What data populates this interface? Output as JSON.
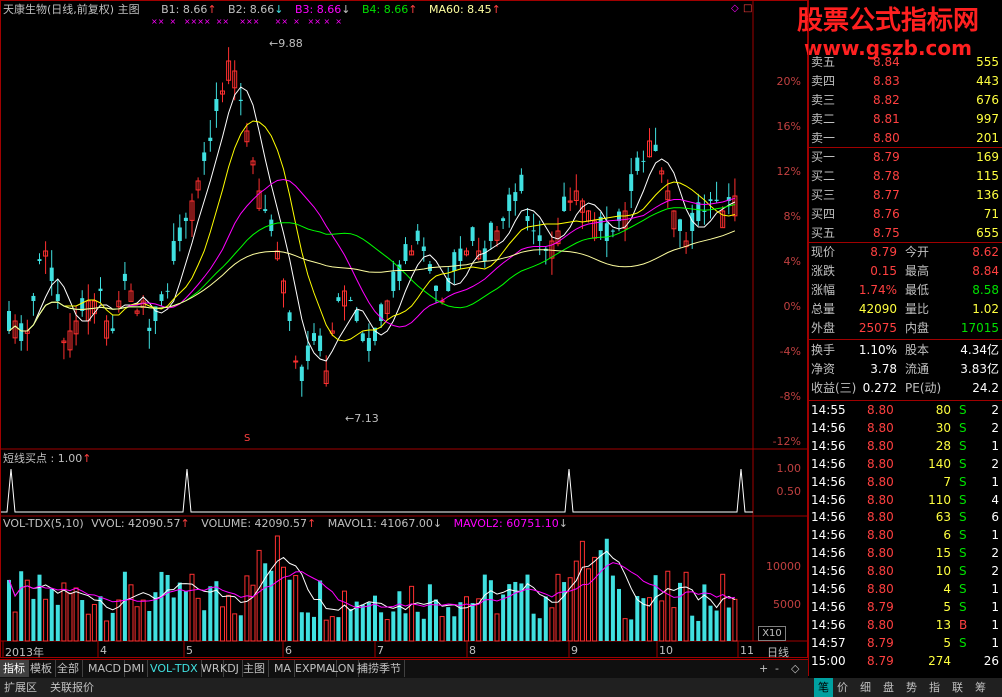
{
  "header": {
    "title": "天康生物(日线,前复权) 主图",
    "b1": "B1: 8.66",
    "b2": "B2: 8.66",
    "b3": "B3: 8.66",
    "b4": "B4: 8.66",
    "ma60": "MA60: 8.45"
  },
  "watermark": {
    "line1": "股票公式指标网",
    "line2": "www.gszb.com"
  },
  "main_chart": {
    "y_labels": [
      "20%",
      "16%",
      "12%",
      "8%",
      "4%",
      "0%",
      "-4%",
      "-8%",
      "-12%"
    ],
    "high_label": "9.88",
    "low_label": "7.13",
    "s_marker": "S"
  },
  "signal_panel": {
    "title": "短线买点 : 1.00",
    "y_labels": [
      "1.00",
      "0.50"
    ]
  },
  "volume_panel": {
    "title": "VOL-TDX(5,10)",
    "vvol": "VVOL: 42090.57",
    "volume": "VOLUME: 42090.57",
    "mavol1": "MAVOL1: 41067.00",
    "mavol2": "MAVOL2: 60751.10",
    "y_labels": [
      "10000",
      "5000"
    ],
    "unit": "X10"
  },
  "x_axis": {
    "labels": [
      "2013年",
      "4",
      "5",
      "6",
      "7",
      "8",
      "9",
      "10",
      "11"
    ],
    "period": "日线"
  },
  "tabs": [
    "指标",
    "模板",
    "全部",
    "MACD",
    "DMI",
    "VOL-TDX",
    "WR",
    "KDJ",
    "主图",
    "MA",
    "EXPMA",
    "LON",
    "捕捞季节"
  ],
  "tab_controls": [
    "+",
    "-",
    "◇"
  ],
  "status_bar": {
    "left": [
      "扩展区",
      "关联报价"
    ],
    "right": [
      "笔",
      "价",
      "细",
      "盘",
      "势",
      "指",
      "联",
      "筹"
    ]
  },
  "orderbook": {
    "asks": [
      {
        "label": "卖五",
        "price": "8.84",
        "vol": "555"
      },
      {
        "label": "卖四",
        "price": "8.83",
        "vol": "443"
      },
      {
        "label": "卖三",
        "price": "8.82",
        "vol": "676"
      },
      {
        "label": "卖二",
        "price": "8.81",
        "vol": "997"
      },
      {
        "label": "卖一",
        "price": "8.80",
        "vol": "201"
      }
    ],
    "bids": [
      {
        "label": "买一",
        "price": "8.79",
        "vol": "169"
      },
      {
        "label": "买二",
        "price": "8.78",
        "vol": "115"
      },
      {
        "label": "买三",
        "price": "8.77",
        "vol": "136"
      },
      {
        "label": "买四",
        "price": "8.76",
        "vol": "71"
      },
      {
        "label": "买五",
        "price": "8.75",
        "vol": "655"
      }
    ]
  },
  "quote": [
    {
      "l1": "现价",
      "v1": "8.79",
      "l2": "今开",
      "v2": "8.62"
    },
    {
      "l1": "涨跌",
      "v1": "0.15",
      "l2": "最高",
      "v2": "8.84"
    },
    {
      "l1": "涨幅",
      "v1": "1.74%",
      "l2": "最低",
      "v2": "8.58"
    },
    {
      "l1": "总量",
      "v1": "42090",
      "l2": "量比",
      "v2": "1.02"
    },
    {
      "l1": "外盘",
      "v1": "25075",
      "l2": "内盘",
      "v2": "17015"
    }
  ],
  "fundamentals": [
    {
      "l1": "换手",
      "v1": "1.10%",
      "l2": "股本",
      "v2": "4.34亿"
    },
    {
      "l1": "净资",
      "v1": "3.78",
      "l2": "流通",
      "v2": "3.83亿"
    },
    {
      "l1": "收益(三)",
      "v1": "0.272",
      "l2": "PE(动)",
      "v2": "24.2"
    }
  ],
  "ticks": [
    {
      "time": "14:55",
      "price": "8.80",
      "vol": "80",
      "side": "S",
      "n": "2"
    },
    {
      "time": "14:56",
      "price": "8.80",
      "vol": "30",
      "side": "S",
      "n": "2"
    },
    {
      "time": "14:56",
      "price": "8.80",
      "vol": "28",
      "side": "S",
      "n": "1"
    },
    {
      "time": "14:56",
      "price": "8.80",
      "vol": "140",
      "side": "S",
      "n": "2"
    },
    {
      "time": "14:56",
      "price": "8.80",
      "vol": "7",
      "side": "S",
      "n": "1"
    },
    {
      "time": "14:56",
      "price": "8.80",
      "vol": "110",
      "side": "S",
      "n": "4"
    },
    {
      "time": "14:56",
      "price": "8.80",
      "vol": "63",
      "side": "S",
      "n": "6"
    },
    {
      "time": "14:56",
      "price": "8.80",
      "vol": "6",
      "side": "S",
      "n": "1"
    },
    {
      "time": "14:56",
      "price": "8.80",
      "vol": "15",
      "side": "S",
      "n": "2"
    },
    {
      "time": "14:56",
      "price": "8.80",
      "vol": "10",
      "side": "S",
      "n": "2"
    },
    {
      "time": "14:56",
      "price": "8.80",
      "vol": "4",
      "side": "S",
      "n": "1"
    },
    {
      "time": "14:56",
      "price": "8.79",
      "vol": "5",
      "side": "S",
      "n": "1"
    },
    {
      "time": "14:56",
      "price": "8.80",
      "vol": "13",
      "side": "B",
      "n": "1"
    },
    {
      "time": "14:57",
      "price": "8.79",
      "vol": "5",
      "side": "S",
      "n": "1"
    },
    {
      "time": "15:00",
      "price": "8.79",
      "vol": "274",
      "side": "",
      "n": "26"
    }
  ],
  "colors": {
    "up": "#ff3030",
    "down": "#40e0e0",
    "ma5": "#ffffff",
    "ma10": "#ffff00",
    "ma20": "#ff00ff",
    "ma30": "#00ff00",
    "ma60": "#ffffa0",
    "frame": "#a00000"
  }
}
